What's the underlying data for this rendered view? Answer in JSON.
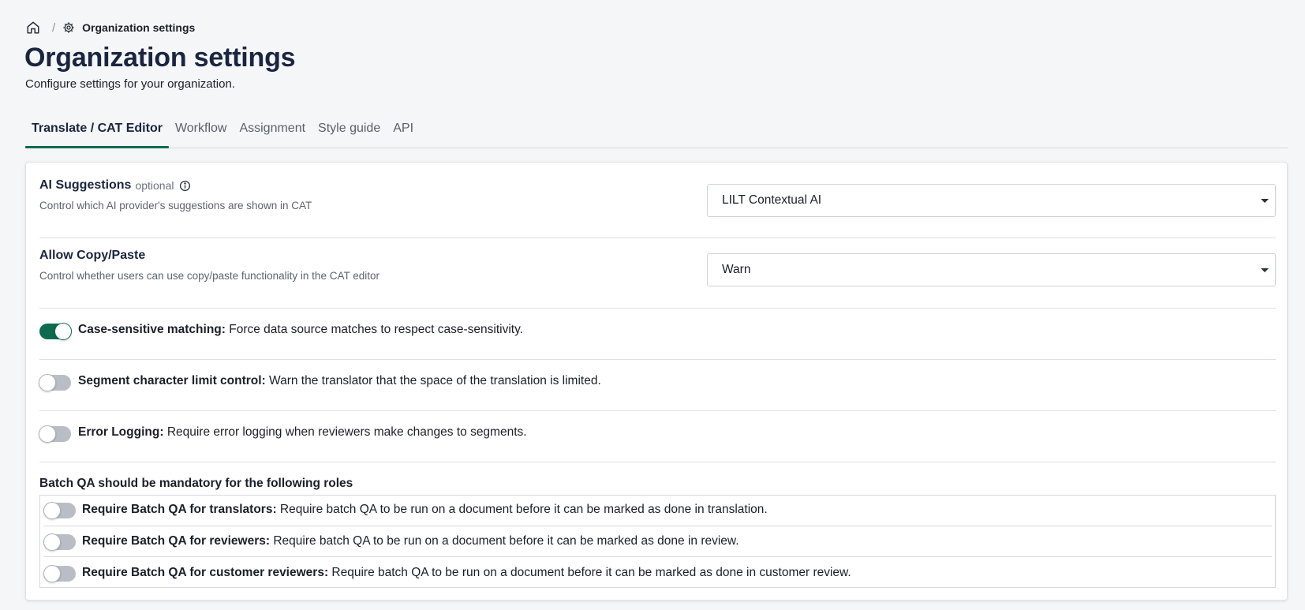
{
  "breadcrumb": {
    "home_icon": "home-icon",
    "separator": "/",
    "current_icon": "gear-icon",
    "current": "Organization settings"
  },
  "page": {
    "title": "Organization settings",
    "subtitle": "Configure settings for your organization."
  },
  "tabs": [
    {
      "label": "Translate / CAT Editor",
      "active": true
    },
    {
      "label": "Workflow",
      "active": false
    },
    {
      "label": "Assignment",
      "active": false
    },
    {
      "label": "Style guide",
      "active": false
    },
    {
      "label": "API",
      "active": false
    }
  ],
  "settings": {
    "ai_suggestions": {
      "title": "AI Suggestions",
      "optional": "optional",
      "description": "Control which AI provider's suggestions are shown in CAT",
      "value": "LILT Contextual AI"
    },
    "copy_paste": {
      "title": "Allow Copy/Paste",
      "description": "Control whether users can use copy/paste functionality in the CAT editor",
      "value": "Warn"
    },
    "toggles": [
      {
        "label": "Case-sensitive matching:",
        "description": "Force data source matches to respect case-sensitivity.",
        "on": true
      },
      {
        "label": "Segment character limit control:",
        "description": "Warn the translator that the space of the translation is limited.",
        "on": false
      },
      {
        "label": "Error Logging:",
        "description": "Require error logging when reviewers make changes to segments.",
        "on": false
      }
    ],
    "batch_qa": {
      "heading": "Batch QA should be mandatory for the following roles",
      "items": [
        {
          "label": "Require Batch QA for translators:",
          "description": "Require batch QA to be run on a document before it can be marked as done in translation.",
          "on": false
        },
        {
          "label": "Require Batch QA for reviewers:",
          "description": "Require batch QA to be run on a document before it can be marked as done in review.",
          "on": false
        },
        {
          "label": "Require Batch QA for customer reviewers:",
          "description": "Require batch QA to be run on a document before it can be marked as done in customer review.",
          "on": false
        }
      ]
    }
  },
  "colors": {
    "accent": "#0f6b4f",
    "title": "#1a2540",
    "toggle_off": "#b9bec6"
  }
}
